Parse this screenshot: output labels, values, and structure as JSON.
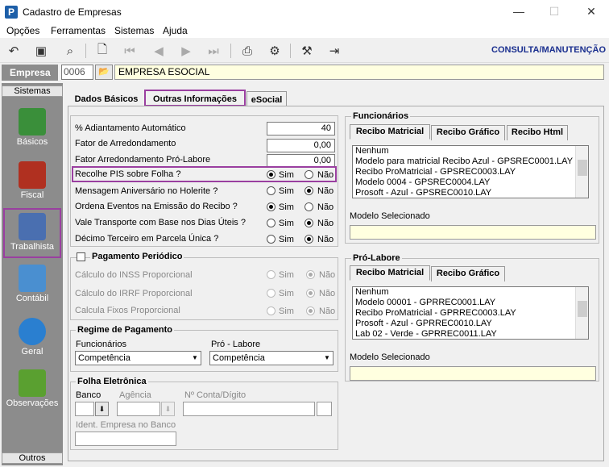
{
  "window": {
    "title": "Cadastro de Empresas",
    "minimize": "—",
    "maximize": "☐",
    "close": "✕"
  },
  "menu": [
    "Opções",
    "Ferramentas",
    "Sistemas",
    "Ajuda"
  ],
  "toolbar": {
    "mode_label": "CONSULTA/MANUTENÇÃO"
  },
  "empresa": {
    "label": "Empresa",
    "code": "0006",
    "name": "EMPRESA ESOCIAL"
  },
  "sidebar": {
    "header_top": "Sistemas",
    "header_bottom": "Outros",
    "items": [
      {
        "label": "Básicos",
        "icon": "basicos-icon",
        "color": "#3a8f3a"
      },
      {
        "label": "Fiscal",
        "icon": "fiscal-icon",
        "color": "#b03020"
      },
      {
        "label": "Trabalhista",
        "icon": "trabalhista-icon",
        "color": "#4a6fb0"
      },
      {
        "label": "Contábil",
        "icon": "contabil-icon",
        "color": "#4a8fd0"
      },
      {
        "label": "Geral",
        "icon": "geral-icon",
        "color": "#2a7fd0"
      },
      {
        "label": "Observações",
        "icon": "observacoes-icon",
        "color": "#5aa030"
      }
    ]
  },
  "tabs": [
    "Dados Básicos",
    "Outras Informações",
    "eSocial"
  ],
  "fields": {
    "adiantamento": {
      "label": "% Adiantamento Automático",
      "value": "40"
    },
    "arredondamento": {
      "label": "Fator de Arredondamento",
      "value": "0,00"
    },
    "arredondamento_pl": {
      "label": "Fator Arredondamento Pró-Labore",
      "value": "0,00"
    }
  },
  "radio_labels": {
    "sim": "Sim",
    "nao": "Não"
  },
  "questions": [
    {
      "label": "Recolhe PIS sobre Folha ?",
      "value": "Sim"
    },
    {
      "label": "Mensagem Aniversário no Holerite ?",
      "value": "Não"
    },
    {
      "label": "Ordena Eventos na Emissão do Recibo ?",
      "value": "Sim"
    },
    {
      "label": "Vale Transporte com Base nos Dias Úteis ?",
      "value": "Não"
    },
    {
      "label": "Décimo Terceiro em Parcela Única ?",
      "value": "Não"
    }
  ],
  "pagamento_periodico": {
    "title": "Pagamento Periódico",
    "items": [
      {
        "label": "Cálculo do INSS Proporcional",
        "value": "Não"
      },
      {
        "label": "Cálculo do IRRF Proporcional",
        "value": "Não"
      },
      {
        "label": "Calcula Fixos Proporcional",
        "value": "Não"
      }
    ]
  },
  "regime": {
    "title": "Regime de Pagamento",
    "funcionarios_label": "Funcionários",
    "funcionarios_value": "Competência",
    "prolabore_label": "Pró - Labore",
    "prolabore_value": "Competência"
  },
  "folha": {
    "title": "Folha Eletrônica",
    "banco": "Banco",
    "agencia": "Agência",
    "conta": "Nº Conta/Dígito",
    "ident": "Ident. Empresa no Banco"
  },
  "funcionarios": {
    "title": "Funcionários",
    "tabs": [
      "Recibo Matricial",
      "Recibo Gráfico",
      "Recibo Html"
    ],
    "list": [
      "Nenhum",
      "Modelo para matricial Recibo Azul - GPSREC0001.LAY",
      "Recibo ProMatricial - GPSREC0003.LAY",
      "Modelo 0004 - GPSREC0004.LAY",
      "Prosoft - Azul - GPSREC0010.LAY"
    ],
    "modelo_label": "Modelo Selecionado"
  },
  "prolabore": {
    "title": "Pró-Labore",
    "tabs": [
      "Recibo Matricial",
      "Recibo Gráfico"
    ],
    "list": [
      "Nenhum",
      "Modelo 00001 - GPRREC0001.LAY",
      "Recibo ProMatricial - GPRREC0003.LAY",
      "Prosoft - Azul - GPRREC0010.LAY",
      "Lab 02 - Verde - GPRREC0011.LAY"
    ],
    "modelo_label": "Modelo Selecionado"
  }
}
